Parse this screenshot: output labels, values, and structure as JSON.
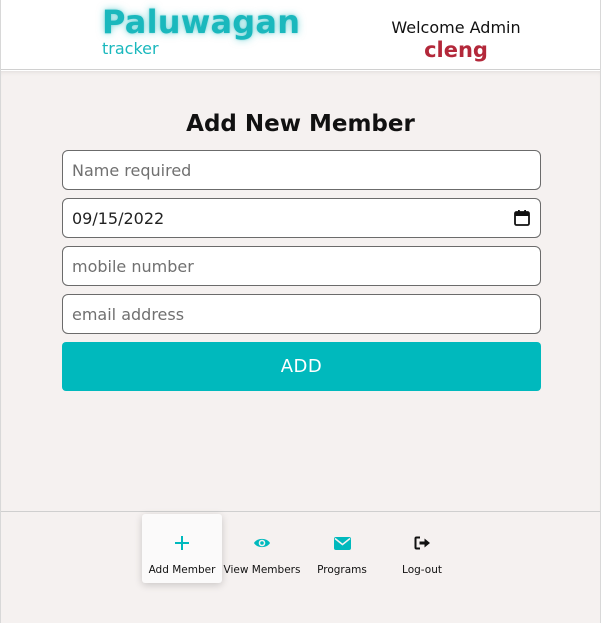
{
  "header": {
    "brand_title": "Paluwagan",
    "brand_sub": "tracker",
    "welcome": "Welcome Admin",
    "admin_name": "cleng"
  },
  "form": {
    "title": "Add New Member",
    "name_placeholder": "Name required",
    "date_value": "09/15/2022",
    "mobile_placeholder": "mobile number",
    "email_placeholder": "email address",
    "add_label": "ADD"
  },
  "nav": {
    "items": [
      {
        "label": "Add Member",
        "icon": "plus-icon"
      },
      {
        "label": "View Members",
        "icon": "eye-icon"
      },
      {
        "label": "Programs",
        "icon": "envelope-icon"
      },
      {
        "label": "Log-out",
        "icon": "logout-icon"
      }
    ],
    "active_index": 0
  },
  "colors": {
    "accent": "#00b9bd",
    "admin_name": "#b3283a",
    "background": "#f5f1f0"
  }
}
